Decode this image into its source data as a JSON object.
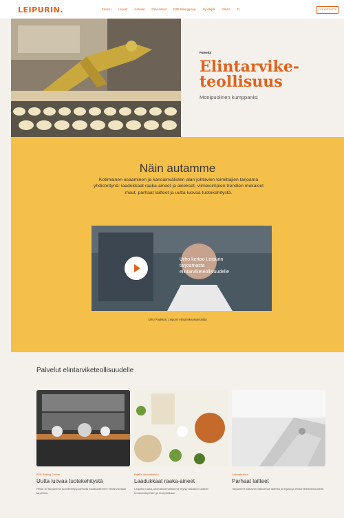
{
  "header": {
    "logo": "LEIPURIN.",
    "nav": [
      "Etusivu",
      "Leipurit",
      "Kahvilat",
      "Palvelutalot",
      "B2B Bakinggroup",
      "Sijoittajille",
      "Media",
      "FI"
    ],
    "cta": "OTA YHTEYTTÄ"
  },
  "hero": {
    "eyebrow": "Palvelut",
    "title_line1": "Elintarvike-",
    "title_line2": "teollisuus",
    "subtitle": "Monipuolinen kumppanisi"
  },
  "help": {
    "title": "Näin autamme",
    "body": "Kotimainen osaaminen ja kansainvälisten alan johtavien toimittajien tarjoama yhdistettynä: laadukkaat raaka-aineet ja ainekset, viimeisimpien trendien mukaiset maut, parhaat laitteet ja uutta luovaa tuotekehitystä.",
    "video_caption_1": "Urho kertoo Leipurin",
    "video_caption_2": "tarjoamasta",
    "video_caption_3": "elintarviketeollisuudelle",
    "video_note": "Urho Paakkari, Leipurin elintarvikeasiantuntija"
  },
  "services": {
    "title": "Palvelut elintarviketeollisuudelle",
    "cards": [
      {
        "tag": "B2B Baking Centre",
        "title": "Uutta luovaa tuotekehitystä",
        "desc": "Reilut 30 tarjoamme tuotekehityspalveluita asiakkaillemme elintarvikealan tarpeisiin."
      },
      {
        "tag": "Raaka-aineratkaisut",
        "title": "Laadukkaat raaka-aineet",
        "desc": "Laajasta raaka-ainevalikoimastamme löytyy ratkaisut kaikkiin tuotantotarpeisiin ja reseptiikkaan."
      },
      {
        "tag": "Laiteratkaisut",
        "title": "Parhaat laitteet",
        "desc": "Tarjoamme kattavan valikoiman laitteita ja linjastoja elintarviketeollisuudelle."
      }
    ]
  }
}
